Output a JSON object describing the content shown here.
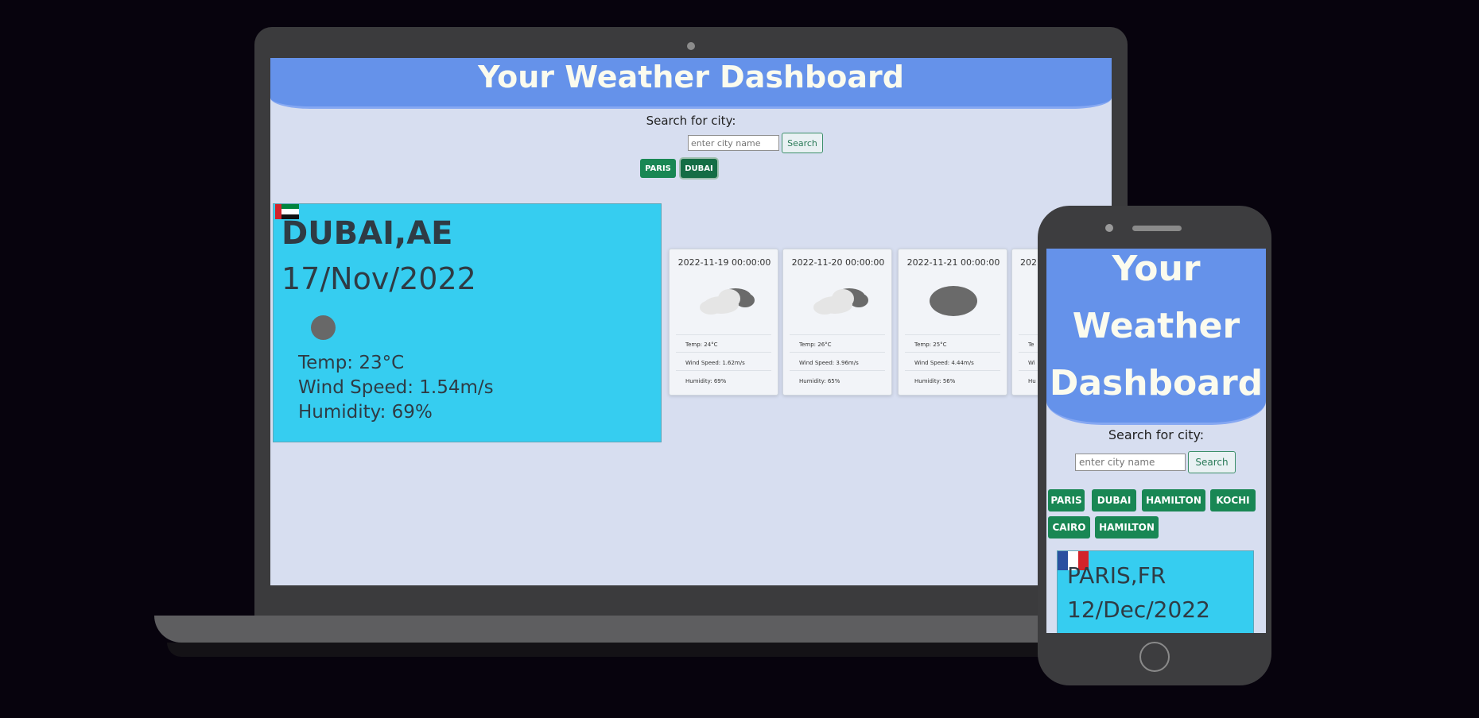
{
  "laptop": {
    "header": {
      "title": "Your Weather Dashboard"
    },
    "search": {
      "label": "Search for city:",
      "placeholder": "enter city name",
      "button": "Search"
    },
    "history": [
      "PARIS",
      "DUBAI"
    ],
    "current": {
      "city": "DUBAI,AE",
      "date": "17/Nov/2022",
      "temp": "Temp: 23°C",
      "wind": "Wind Speed: 1.54m/s",
      "humidity": "Humidity: 69%"
    },
    "forecast": [
      {
        "date": "2022-11-19 00:00:00",
        "icon": "broken-clouds-icon",
        "temp": "Temp: 24°C",
        "wind": "Wind Speed: 1.62m/s",
        "humidity": "Humidity: 69%"
      },
      {
        "date": "2022-11-20 00:00:00",
        "icon": "broken-clouds-icon",
        "temp": "Temp: 26°C",
        "wind": "Wind Speed: 3.96m/s",
        "humidity": "Humidity: 65%"
      },
      {
        "date": "2022-11-21 00:00:00",
        "icon": "overcast-icon",
        "temp": "Temp: 25°C",
        "wind": "Wind Speed: 4.44m/s",
        "humidity": "Humidity: 56%"
      },
      {
        "date": "202",
        "temp": "Te",
        "wind": "Wi",
        "humidity": "Hu"
      }
    ]
  },
  "phone": {
    "header": {
      "title_lines": [
        "Your",
        "Weather",
        "Dashboard"
      ]
    },
    "search": {
      "label": "Search for city:",
      "placeholder": "enter city name",
      "button": "Search"
    },
    "history": [
      "PARIS",
      "DUBAI",
      "HAMILTON",
      "KOCHI",
      "CAIRO",
      "HAMILTON"
    ],
    "current": {
      "city": "PARIS,FR",
      "date": "12/Dec/2022"
    }
  },
  "colors": {
    "header": "#6592ea",
    "page_bg": "#d7def0",
    "current_card": "#36cdf0",
    "history_button": "#198754",
    "header_text": "#fbfbee"
  }
}
